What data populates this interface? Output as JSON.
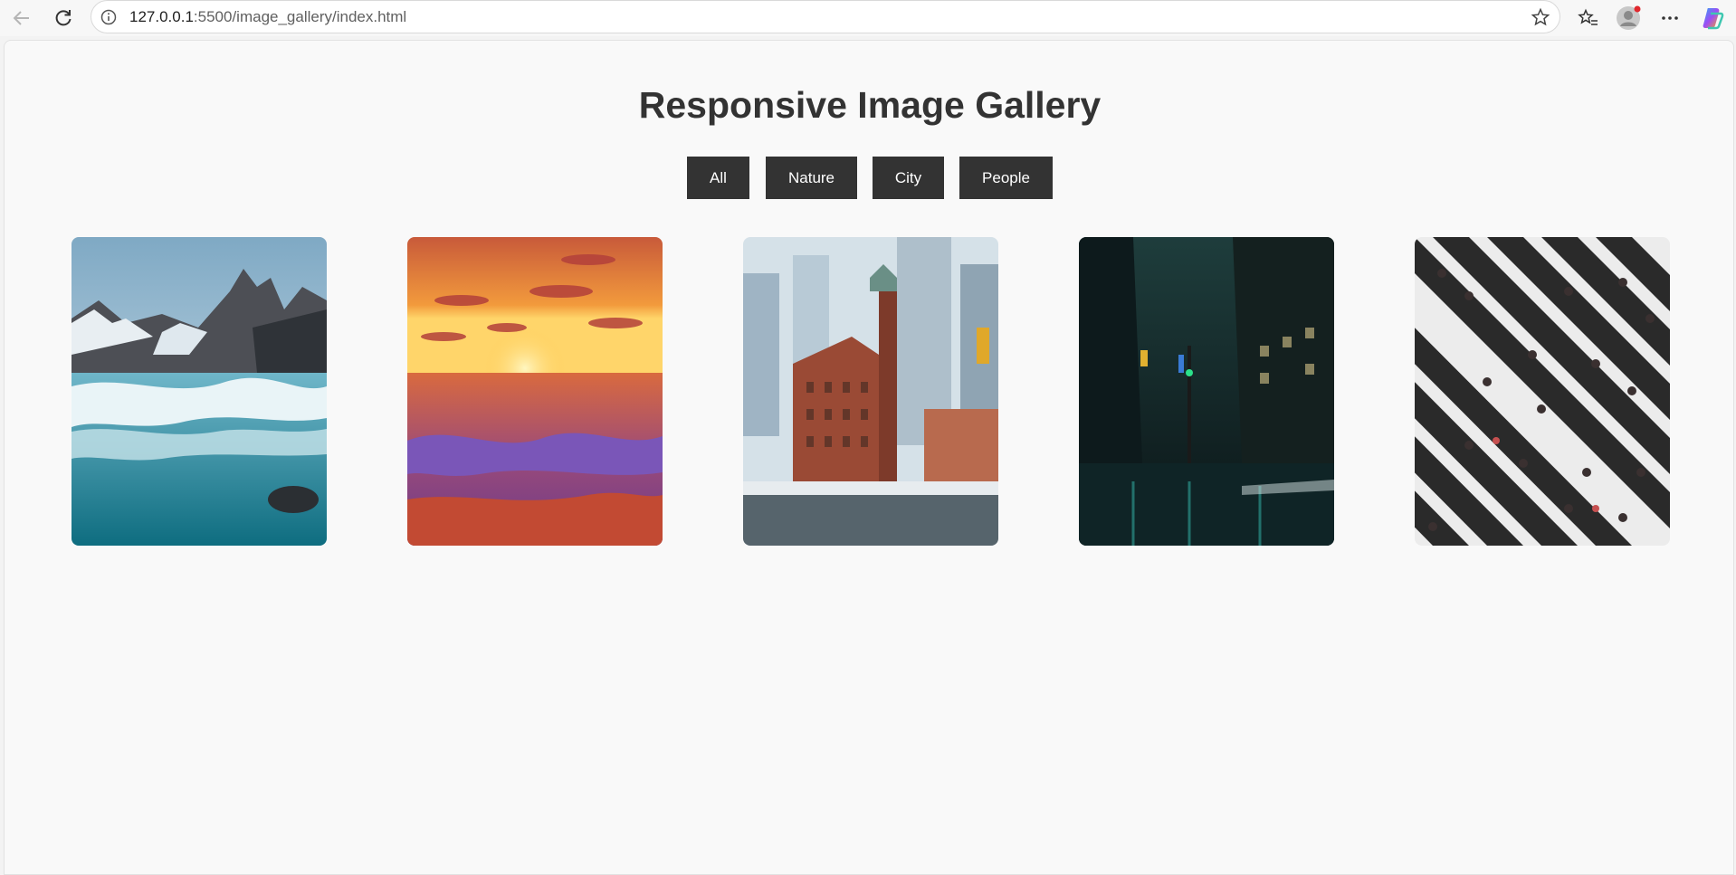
{
  "browser": {
    "url_host": "127.0.0.1",
    "url_path": ":5500/image_gallery/index.html",
    "icons": [
      "back-arrow-icon",
      "reload-icon",
      "info-icon",
      "star-icon",
      "favorites-icon",
      "profile-avatar-icon",
      "more-menu-icon",
      "copilot-icon"
    ]
  },
  "page": {
    "title": "Responsive Image Gallery"
  },
  "filters": [
    {
      "label": "All"
    },
    {
      "label": "Nature"
    },
    {
      "label": "City"
    },
    {
      "label": "People"
    }
  ],
  "gallery": [
    {
      "category": "nature",
      "subject": "mountain river"
    },
    {
      "category": "nature",
      "subject": "sunset over sea"
    },
    {
      "category": "city",
      "subject": "flatiron building"
    },
    {
      "category": "city",
      "subject": "night street"
    },
    {
      "category": "people",
      "subject": "crosswalk crowd"
    }
  ],
  "colors": {
    "button_bg": "#333333",
    "button_text": "#ffffff",
    "title_text": "#333333",
    "page_bg": "#f9f9f9"
  }
}
